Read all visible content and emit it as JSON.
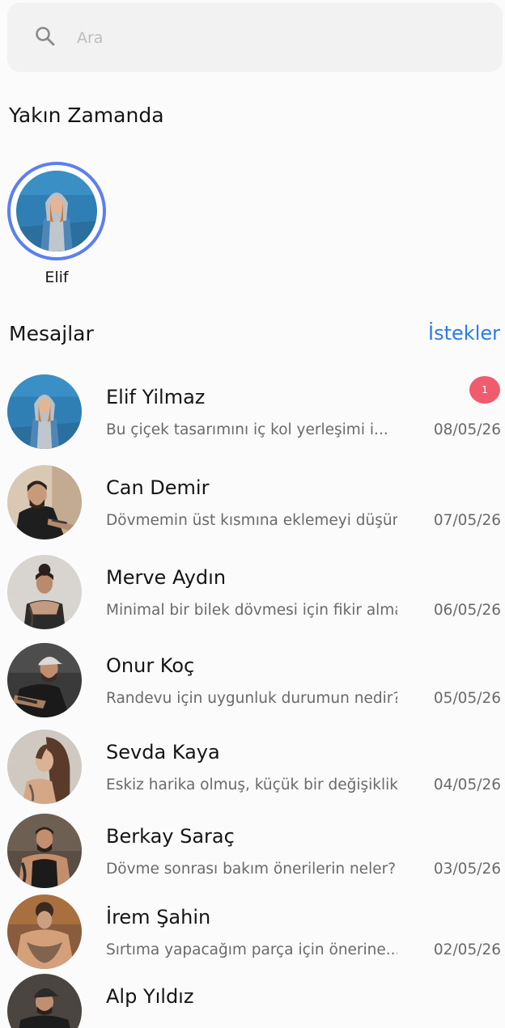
{
  "search": {
    "placeholder": "Ara",
    "value": ""
  },
  "recent": {
    "title": "Yakın Zamanda",
    "stories": [
      {
        "name": "Elif",
        "ring_color": "#5b7ff0"
      }
    ]
  },
  "messages": {
    "title": "Mesajlar",
    "requests_label": "İstekler",
    "accent_color": "#2b7bea",
    "items": [
      {
        "name": "Elif Yilmaz",
        "preview": "Bu çiçek tasarımını iç kol yerleşimi i...",
        "date": "08/05/26",
        "unread": "1"
      },
      {
        "name": "Can Demir",
        "preview": "Dövmemin üst kısmına eklemeyi düşündüğün...",
        "date": "07/05/26",
        "unread": ""
      },
      {
        "name": "Merve Aydın",
        "preview": "Minimal bir bilek dövmesi için fikir almak...",
        "date": "06/05/26",
        "unread": ""
      },
      {
        "name": "Onur Koç",
        "preview": "Randevu için uygunluk durumun nedir?",
        "date": "05/05/26",
        "unread": ""
      },
      {
        "name": "Sevda Kaya",
        "preview": "Eskiz harika olmuş, küçük bir değişiklik...",
        "date": "04/05/26",
        "unread": ""
      },
      {
        "name": "Berkay Saraç",
        "preview": "Dövme sonrası bakım önerilerin neler?",
        "date": "03/05/26",
        "unread": ""
      },
      {
        "name": "İrem Şahin",
        "preview": "Sırtıma yapacağım parça için önerine...",
        "date": "02/05/26",
        "unread": ""
      },
      {
        "name": "Alp Yıldız",
        "preview": "",
        "date": "",
        "unread": ""
      }
    ]
  }
}
